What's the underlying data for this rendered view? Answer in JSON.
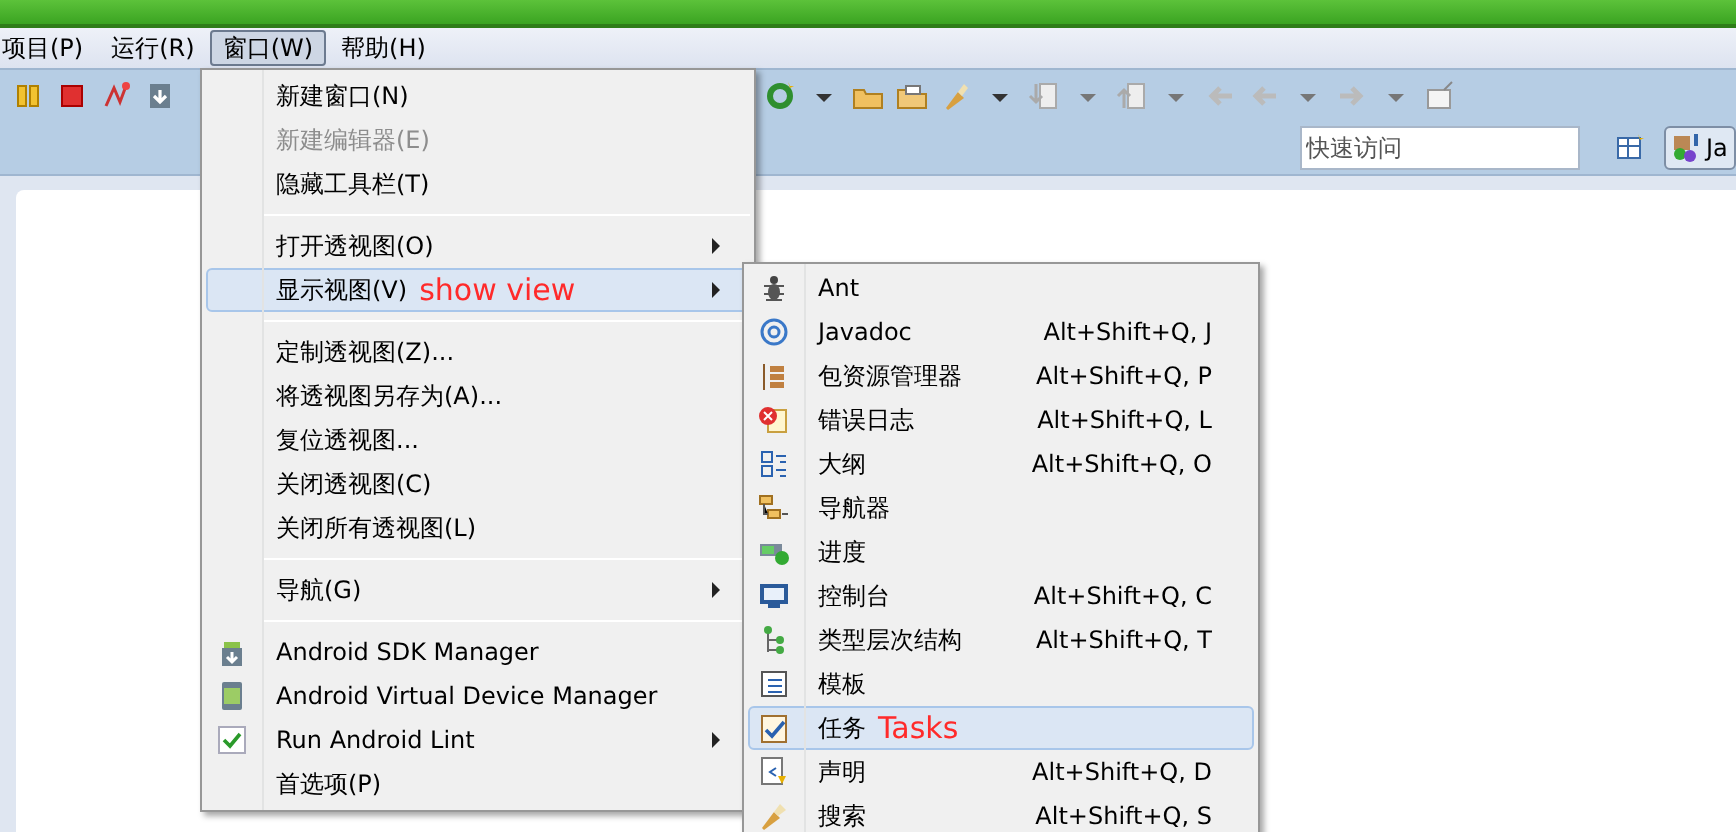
{
  "menubar": [
    {
      "label": "项目(P)",
      "selected": false
    },
    {
      "label": "运行(R)",
      "selected": false
    },
    {
      "label": "窗口(W)",
      "selected": true
    },
    {
      "label": "帮助(H)",
      "selected": false
    }
  ],
  "quick_access": {
    "placeholder": "快速访问"
  },
  "perspective_button": {
    "label": "Ja"
  },
  "window_menu": [
    {
      "kind": "item",
      "label": "新建窗口(N)",
      "disabled": false,
      "selected": false,
      "submenu": false
    },
    {
      "kind": "item",
      "label": "新建编辑器(E)",
      "disabled": true,
      "selected": false,
      "submenu": false
    },
    {
      "kind": "item",
      "label": "隐藏工具栏(T)",
      "disabled": false,
      "selected": false,
      "submenu": false
    },
    {
      "kind": "separator"
    },
    {
      "kind": "item",
      "label": "打开透视图(O)",
      "disabled": false,
      "selected": false,
      "submenu": true
    },
    {
      "kind": "item",
      "label": "显示视图(V)",
      "note": "show view",
      "disabled": false,
      "selected": true,
      "submenu": true
    },
    {
      "kind": "separator"
    },
    {
      "kind": "item",
      "label": "定制透视图(Z)...",
      "disabled": false,
      "selected": false,
      "submenu": false
    },
    {
      "kind": "item",
      "label": "将透视图另存为(A)...",
      "disabled": false,
      "selected": false,
      "submenu": false
    },
    {
      "kind": "item",
      "label": "复位透视图...",
      "disabled": false,
      "selected": false,
      "submenu": false
    },
    {
      "kind": "item",
      "label": "关闭透视图(C)",
      "disabled": false,
      "selected": false,
      "submenu": false
    },
    {
      "kind": "item",
      "label": "关闭所有透视图(L)",
      "disabled": false,
      "selected": false,
      "submenu": false
    },
    {
      "kind": "separator"
    },
    {
      "kind": "item",
      "label": "导航(G)",
      "disabled": false,
      "selected": false,
      "submenu": true
    },
    {
      "kind": "separator"
    },
    {
      "kind": "item",
      "label": "Android SDK Manager",
      "disabled": false,
      "selected": false,
      "submenu": false
    },
    {
      "kind": "item",
      "label": "Android Virtual Device Manager",
      "disabled": false,
      "selected": false,
      "submenu": false
    },
    {
      "kind": "item",
      "label": "Run Android Lint",
      "disabled": false,
      "selected": false,
      "submenu": true
    },
    {
      "kind": "item",
      "label": "首选项(P)",
      "disabled": false,
      "selected": false,
      "submenu": false
    }
  ],
  "show_view_menu": [
    {
      "label": "Ant",
      "selected": false
    },
    {
      "label": "Javadoc",
      "shortcut": "Alt+Shift+Q, J",
      "selected": false
    },
    {
      "label": "包资源管理器",
      "shortcut": "Alt+Shift+Q, P",
      "selected": false
    },
    {
      "label": "错误日志",
      "shortcut": "Alt+Shift+Q, L",
      "selected": false
    },
    {
      "label": "大纲",
      "shortcut": "Alt+Shift+Q, O",
      "selected": false
    },
    {
      "label": "导航器",
      "selected": false
    },
    {
      "label": "进度",
      "selected": false
    },
    {
      "label": "控制台",
      "shortcut": "Alt+Shift+Q, C",
      "selected": false
    },
    {
      "label": "类型层次结构",
      "shortcut": "Alt+Shift+Q, T",
      "selected": false
    },
    {
      "label": "模板",
      "selected": false
    },
    {
      "label": "任务",
      "note": "Tasks",
      "selected": true
    },
    {
      "label": "声明",
      "shortcut": "Alt+Shift+Q, D",
      "selected": false
    },
    {
      "label": "搜索",
      "shortcut": "Alt+Shift+Q, S",
      "selected": false
    }
  ]
}
